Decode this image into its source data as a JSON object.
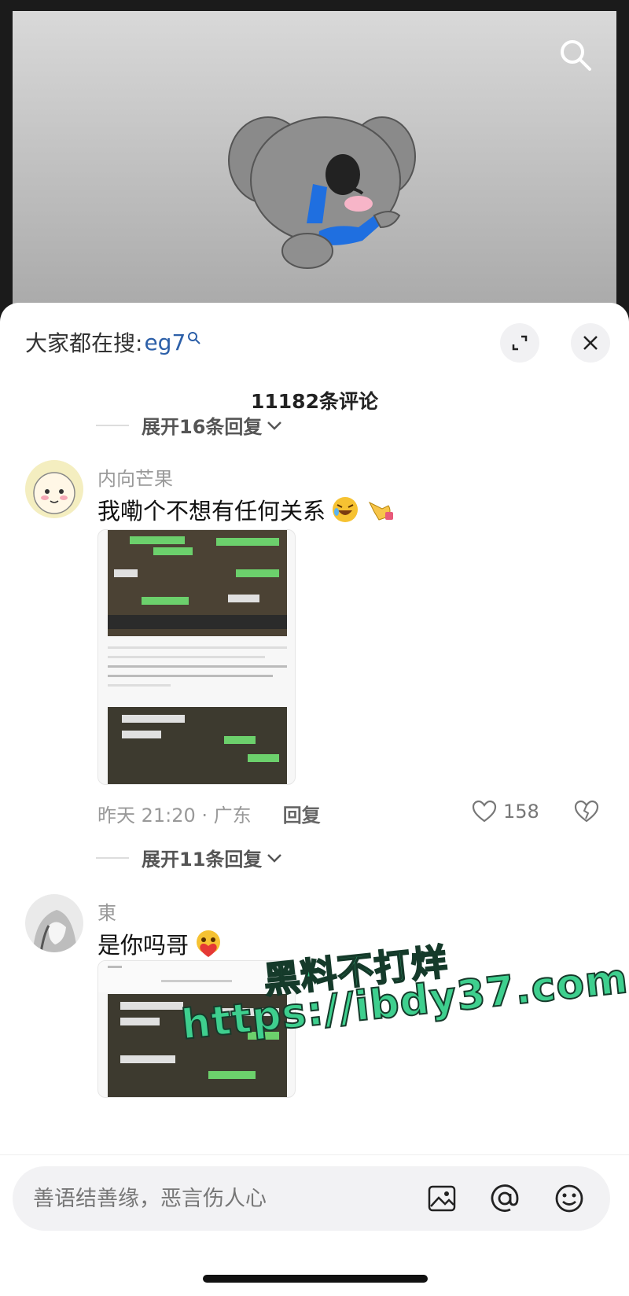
{
  "header": {
    "hot_search_label": "大家都在搜:",
    "hot_search_keyword": "eg7"
  },
  "comment_count": "11182条评论",
  "expand_replies_top": "展开16条回复",
  "comments": [
    {
      "username": "内向芒果",
      "text": "我嘞个不想有任何关系",
      "emojis": [
        "rolling-laughing-emoji",
        "pointing-hand-emoji"
      ],
      "time_location": "昨天 21:20 · 广东",
      "reply_label": "回复",
      "likes": "158",
      "image_text": "再后来，我们经常因为一些小事吵架，男主也始终没有正面回应过我们的关系，9月10号这天，他彻底跟我摊牌了：从一开始他就有对象，现在不想跟我有任何关系，然后我们就断了。",
      "image_caption": "（我和男主的对话）"
    },
    {
      "username": "東",
      "text": "是你吗哥",
      "emojis": [
        "heart-hug-emoji"
      ],
      "image_caption": "（我和男主的对话）",
      "image_top_text": "断了。"
    }
  ],
  "expand_replies_second": "展开11条回复",
  "watermark": {
    "line1": "黑料不打烊",
    "line2": "https://ibdy37.com"
  },
  "input": {
    "placeholder": "善语结善缘，恶言伤人心"
  },
  "colors": {
    "keyword": "#2c5fa8",
    "watermark": "#3ecf8e"
  }
}
